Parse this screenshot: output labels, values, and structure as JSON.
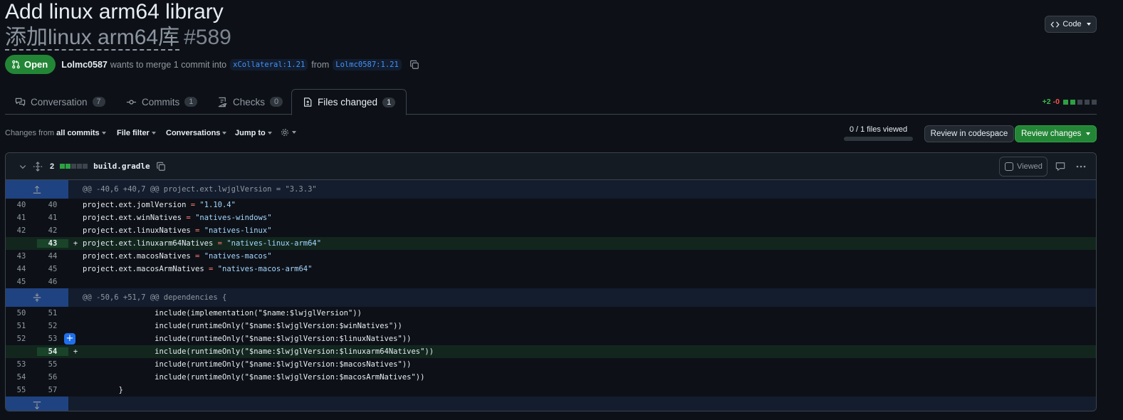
{
  "pr": {
    "title_en": "Add linux arm64 library",
    "title_zh": "添加linux arm64库",
    "number": "#589",
    "state": "Open",
    "author": "Lolmc0587",
    "merge_text": "wants to merge 1 commit into",
    "base_branch": "xCollateral:1.21",
    "from_text": "from",
    "head_branch": "Lolmc0587:1.21"
  },
  "code_button": "Code",
  "tabs": [
    {
      "label": "Conversation",
      "count": "7"
    },
    {
      "label": "Commits",
      "count": "1"
    },
    {
      "label": "Checks",
      "count": "0"
    },
    {
      "label": "Files changed",
      "count": "1"
    }
  ],
  "diffstat": {
    "additions": "+2",
    "deletions": "-0"
  },
  "toolbar": {
    "changes_from_prefix": "Changes from",
    "changes_from_value": "all commits",
    "file_filter": "File filter",
    "conversations": "Conversations",
    "jump_to": "Jump to",
    "files_viewed": "0 / 1 files viewed",
    "review_codespace": "Review in codespace",
    "review_changes": "Review changes"
  },
  "file": {
    "change_count": "2",
    "name": "build.gradle",
    "viewed_label": "Viewed",
    "hunk1": "@@ -40,6 +40,7 @@ project.ext.lwjglVersion = \"3.3.3\"",
    "hunk2": "@@ -50,6 +51,7 @@ dependencies {"
  },
  "colors": {
    "background": "#0d1117",
    "open_green": "#238636",
    "addition_bg": "#12261e",
    "hunk_blue": "#1f4280",
    "link_blue": "#4493f8"
  }
}
